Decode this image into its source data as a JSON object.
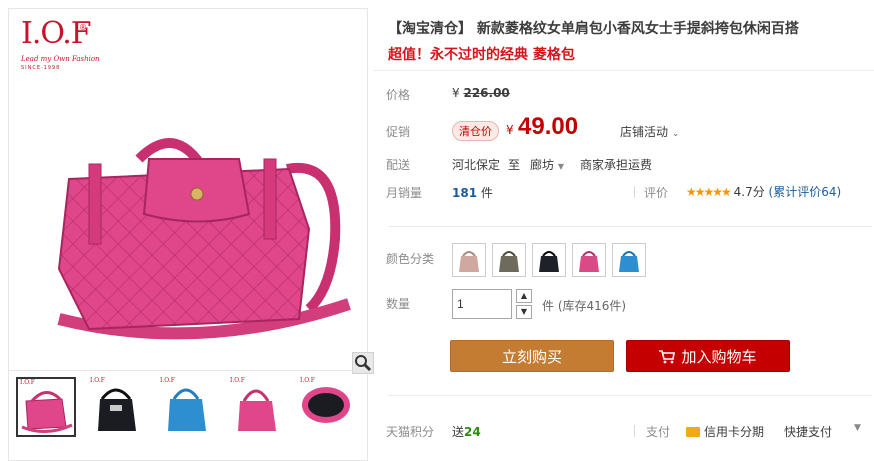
{
  "brand": {
    "logo_text": "I.O.F",
    "logo_reg": "®",
    "logo_tagline": "Lead my Own Fashion",
    "logo_since": "SINCE·1998"
  },
  "product": {
    "title": "【淘宝清仓】 新款菱格纹女单肩包小香风女士手提斜挎包休闲百搭",
    "subtitle": "超值！永不过时的经典 菱格包"
  },
  "price": {
    "label": "价格",
    "original": "226.00",
    "currency": "¥"
  },
  "promo": {
    "label": "促销",
    "badge": "清仓价",
    "currency": "¥",
    "value": "49.00",
    "activity": "店铺活动"
  },
  "delivery": {
    "label": "配送",
    "from": "河北保定",
    "to_word": "至",
    "to": "廊坊",
    "shipping": "商家承担运费"
  },
  "sales": {
    "label": "月销量",
    "count": "181",
    "unit": "件",
    "rating_label": "评价",
    "stars": "★★★★★",
    "score": "4.7分",
    "reviews": "(累计评价64)"
  },
  "color": {
    "label": "颜色分类",
    "swatches": [
      "#cfa9a0",
      "#6e6a5c",
      "#1e2129",
      "#d94b86",
      "#2d8fd0"
    ]
  },
  "quantity": {
    "label": "数量",
    "value": "1",
    "up": "▲",
    "down": "▼",
    "stock": "件 (库存416件)"
  },
  "actions": {
    "buy_label": "立刻购买",
    "cart_label": "加入购物车"
  },
  "footer": {
    "points_label": "天猫积分",
    "points_prefix": "送",
    "points_value": "24",
    "pay_label": "支付",
    "credit_label": "信用卡分期",
    "quick_label": "快捷支付"
  },
  "colors": {
    "accent": "#c40000",
    "buy": "#c47c33",
    "bag": "#e0468a"
  }
}
